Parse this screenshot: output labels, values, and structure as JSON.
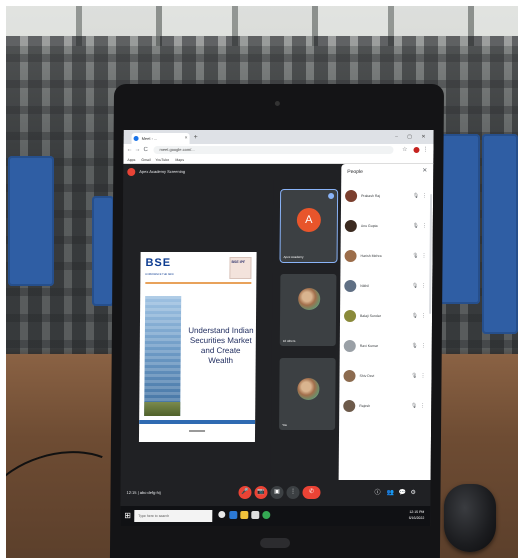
{
  "browser": {
    "tab_title": "Meet - ...",
    "tab_close": "×",
    "new_tab": "+",
    "window_controls": "–  ▢  ✕",
    "nav_back": "←",
    "nav_forward": "→",
    "nav_reload": "C",
    "url": "meet.google.com/...",
    "star_icon": "☆",
    "menu_icon": "⋮",
    "bookmarks": [
      "Apps",
      "Gmail",
      "YouTube",
      "Maps"
    ]
  },
  "meet": {
    "title": "Apex Academy Screening",
    "slide": {
      "brand": "BSE",
      "brand_sub": "EXPERIENCE THE NEW",
      "partner": "BSE IPF",
      "headline": "Understand Indian Securities Market and Create Wealth"
    },
    "tiles": [
      {
        "label": "Apex Academy",
        "avatar_letter": "A"
      },
      {
        "label": "10 others"
      },
      {
        "label": "You"
      }
    ],
    "people_panel": {
      "title": "People",
      "close_icon": "✕",
      "mic_icon": "🎙",
      "more_icon": "⋮",
      "participants": [
        {
          "name": "Prakash Raj",
          "color": "#7b3f2e"
        },
        {
          "name": "Anu Gupta",
          "color": "#3b2a20"
        },
        {
          "name": "Harish Mehra",
          "color": "#9c6d4a"
        },
        {
          "name": "Nikhil",
          "color": "#5f6f84"
        },
        {
          "name": "Balaji Sundar",
          "color": "#8a8a3a"
        },
        {
          "name": "Ravi Kumar",
          "color": "#9aa0a6"
        },
        {
          "name": "Shiv Devi",
          "color": "#8c6b4f"
        },
        {
          "name": "Rajesh",
          "color": "#6d5a4a"
        }
      ]
    },
    "controls": {
      "time": "12:15  |  abc-defg-hij",
      "mic_icon": "🎤",
      "cam_icon": "📷",
      "present_icon": "▣",
      "more_icon": "⋮",
      "end_icon": "✆",
      "right_icons": [
        "ⓘ",
        "👥",
        "💬",
        "⚙"
      ]
    }
  },
  "taskbar": {
    "start_icon": "⊞",
    "search_placeholder": "Type here to search",
    "tray_time": "12:15 PM",
    "tray_date": "6/16/2022"
  },
  "colors": {
    "meet_bg": "#202124",
    "end_call": "#ea4335",
    "avatar_orange": "#e8552b",
    "bse_blue": "#0d3c91",
    "chair_blue": "#2f5ea4"
  }
}
